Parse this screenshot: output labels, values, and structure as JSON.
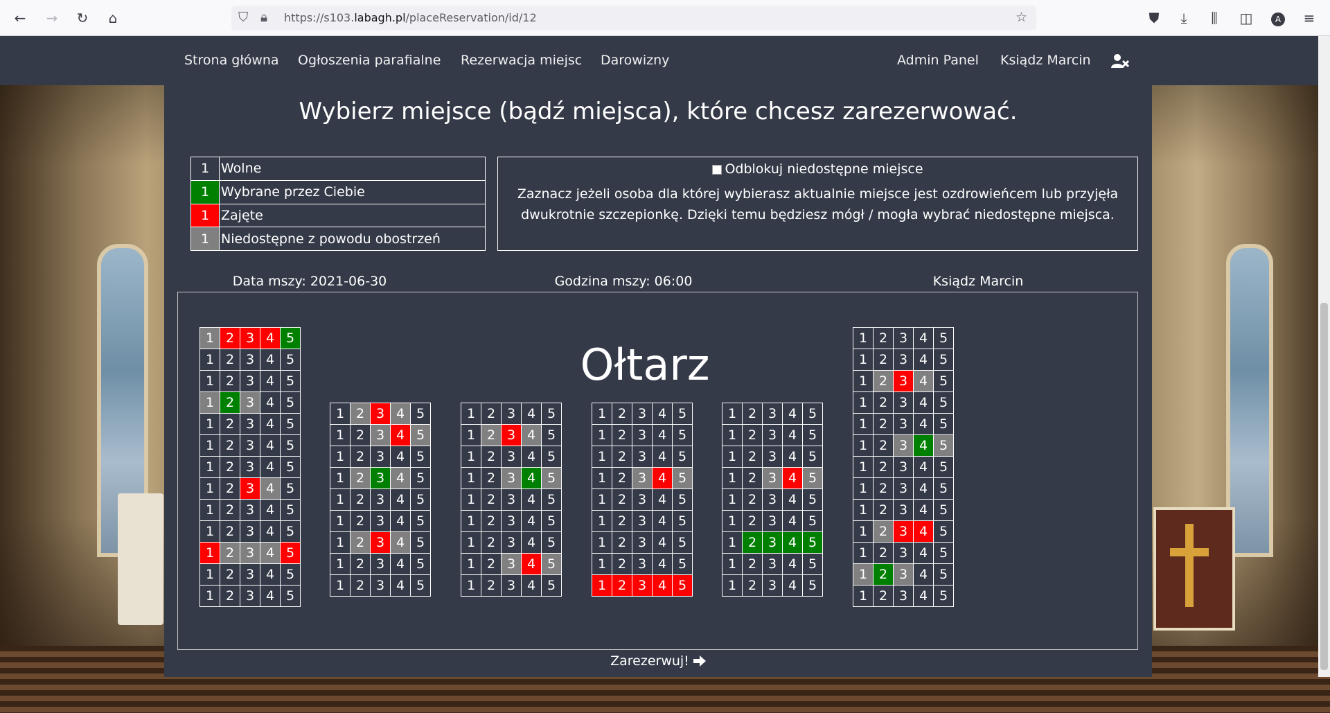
{
  "browser": {
    "url_prefix": "https://s103.",
    "url_domain": "labagh.pl",
    "url_path": "/placeReservation/id/12",
    "icons": [
      "back-icon",
      "forward-icon",
      "reload-icon",
      "home-icon",
      "shield-icon",
      "lock-icon",
      "star-icon",
      "pocket-icon",
      "download-icon",
      "library-icon",
      "sidebar-icon",
      "account-icon",
      "menu-icon"
    ],
    "account_letter": "A"
  },
  "nav": {
    "home": "Strona główna",
    "announcements": "Ogłoszenia parafialne",
    "reservation": "Rezerwacja miejsc",
    "donations": "Darowizny",
    "admin": "Admin Panel",
    "user": "Ksiądz Marcin"
  },
  "page": {
    "heading": "Wybierz miejsce (bądź miejsca), które chcesz zarezerwować.",
    "legend": [
      {
        "num": "1",
        "label": "Wolne",
        "state": "free"
      },
      {
        "num": "1",
        "label": "Wybrane przez Ciebie",
        "state": "selected"
      },
      {
        "num": "1",
        "label": "Zajęte",
        "state": "taken"
      },
      {
        "num": "1",
        "label": "Niedostępne z powodu obostrzeń",
        "state": "unavailable"
      }
    ],
    "unlock_label": "Odblokuj niedostępne miejsce",
    "unlock_checked": false,
    "unlock_description": "Zaznacz jeżeli osoba dla której wybierasz aktualnie miejsce jest ozdrowieńcem lub przyjęła dwukrotnie szczepionkę. Dzięki temu będziesz mógł / mogła wybrać niedostępne miejsca.",
    "mass_date": "Data mszy: 2021-06-30",
    "mass_time": "Godzina mszy: 06:00",
    "priest": "Ksiądz Marcin",
    "altar": "Ołtarz",
    "reserve_button": "Zarezerwuj!"
  },
  "colors": {
    "free": "transparent",
    "selected": "#008000",
    "taken": "#ff0000",
    "unavailable": "#808080",
    "panel": "#343a48"
  },
  "seating_legend": "f=free, s=selected, t=taken, u=unavailable",
  "sections": [
    {
      "rows": [
        "uttts",
        "fffff",
        "fffff",
        "usuff",
        "fffff",
        "fffff",
        "fffff",
        "fftuf",
        "fffff",
        "fffff",
        "tuuut",
        "fffff",
        "fffff"
      ]
    },
    {
      "rows": [
        "futuf",
        "ffutu",
        "fffff",
        "fusuf",
        "fffff",
        "fffff",
        "futuf",
        "fffff",
        "fffff"
      ]
    },
    {
      "rows": [
        "fffff",
        "futuf",
        "fffff",
        "ffusu",
        "fffff",
        "fffff",
        "fffff",
        "ffutu",
        "fffff"
      ]
    },
    {
      "rows": [
        "fffff",
        "fffff",
        "fffff",
        "ffutu",
        "fffff",
        "fffff",
        "fffff",
        "fffff",
        "ttttt"
      ]
    },
    {
      "rows": [
        "fffff",
        "fffff",
        "fffff",
        "ffutu",
        "fffff",
        "fffff",
        "fssss",
        "fffff",
        "fffff"
      ]
    },
    {
      "rows": [
        "fffff",
        "fffff",
        "futuf",
        "fffff",
        "fffff",
        "ffusu",
        "fffff",
        "fffff",
        "fffff",
        "futtf",
        "fffff",
        "usuff",
        "fffff"
      ]
    }
  ]
}
